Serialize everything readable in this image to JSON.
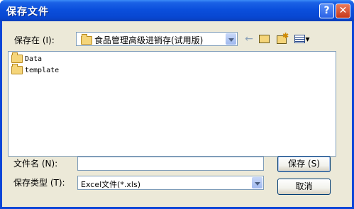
{
  "window": {
    "title": "保存文件",
    "help_glyph": "?",
    "close_glyph": "✕"
  },
  "location": {
    "label": "保存在 (I):",
    "value": "食品管理高级进销存(试用版)",
    "icons": [
      "back-arrow-icon",
      "up-folder-icon",
      "new-folder-icon",
      "view-menu-icon"
    ]
  },
  "files": [
    {
      "name": "Data",
      "icon": "folder-icon"
    },
    {
      "name": "template",
      "icon": "folder-icon"
    }
  ],
  "filename": {
    "label": "文件名 (N):",
    "value": ""
  },
  "filetype": {
    "label": "保存类型 (T):",
    "value": "Excel文件(*.xls)"
  },
  "buttons": {
    "save": "保存 (S)",
    "cancel": "取消"
  }
}
